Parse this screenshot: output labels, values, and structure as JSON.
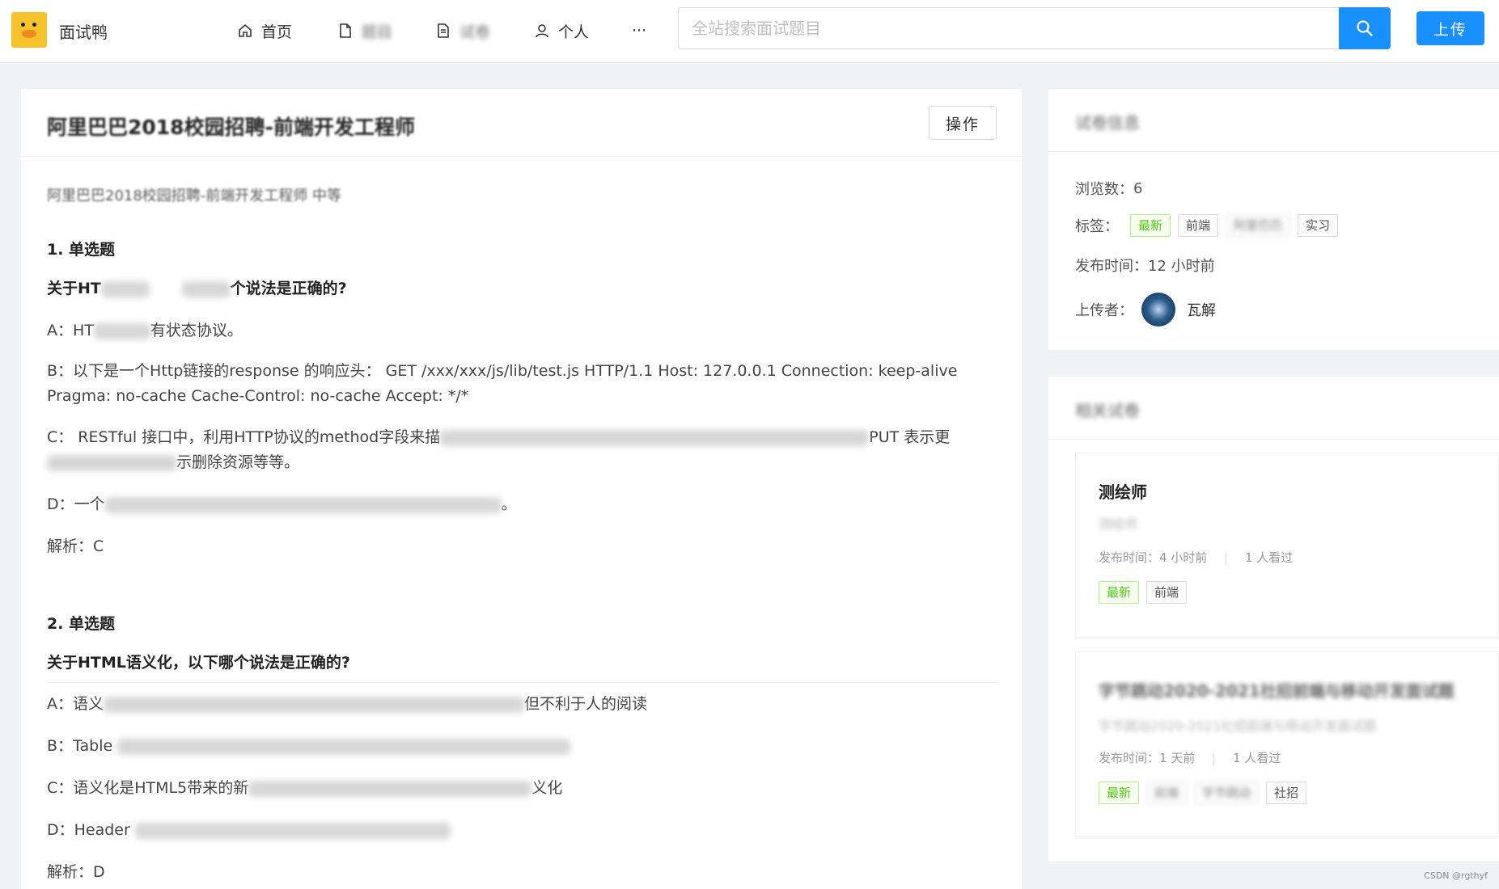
{
  "header": {
    "app_name": "面试鸭",
    "nav": [
      {
        "label": "首页",
        "icon": "home-icon"
      },
      {
        "label": "题目",
        "icon": "file-icon"
      },
      {
        "label": "试卷",
        "icon": "file-text-icon"
      },
      {
        "label": "个人",
        "icon": "user-icon"
      },
      {
        "label": "···",
        "icon": "more-icon"
      }
    ],
    "search_placeholder": "全站搜索面试题目",
    "upload_label": "上传"
  },
  "paper": {
    "title": "阿里巴巴2018校园招聘-前端开发工程师",
    "operate_label": "操作",
    "description": "阿里巴巴2018校园招聘-前端开发工程师 中等",
    "questions": [
      {
        "number": "1. 单选题",
        "text": "关于HTTP协议，以下哪个说法是正确的?",
        "options": [
          "A：HTTP是一种有状态协议。",
          "B：以下是一个Http链接的response 的响应头： GET /xxx/xxx/js/lib/test.js HTTP/1.1 Host: 127.0.0.1 Connection: keep-alive Pragma: no-cache Cache-Control: no-cache Accept: */*",
          "C： RESTful 接口中，利用HTTP协议的method字段来描述要对资源操作的方式，比如GET表示获取资源，POST表示新增一个资源，PUT表示更新资源，DELETE表示删除资源等等。",
          "D：一个HTTP请求返回的HTTP状态码中，304表示临时重定向。"
        ],
        "analysis": "解析：C"
      },
      {
        "number": "2. 单选题",
        "text": "关于HTML语义化，以下哪个说法是正确的?",
        "options": [
          "A：语义化的HTML有利于机器的阅读，如PDA手持设备、搜索引擎爬虫；但不利于人的阅读",
          "B：Table 属于过时的标签，遇到数据列表时，需尽量使用 div 来模拟表格",
          "C：语义化是HTML5带来的新概念，此前版本的HTML无法做到语义化",
          "D：Header、article、address都属于语义化明确的标签"
        ],
        "analysis": "解析：D"
      }
    ]
  },
  "info": {
    "title": "试卷信息",
    "views_label": "浏览数：",
    "views_value": "6",
    "tags_label": "标签：",
    "tags": [
      {
        "label": "最新",
        "green": true
      },
      {
        "label": "前端",
        "green": false
      },
      {
        "label": "阿里巴巴",
        "green": false
      },
      {
        "label": "实习",
        "green": false
      }
    ],
    "time_label": "发布时间：",
    "time_value": "12 小时前",
    "uploader_label": "上传者：",
    "uploader_name": "瓦解"
  },
  "related": {
    "title": "相关试卷",
    "items": [
      {
        "title": "测绘师",
        "sub": "测绘师",
        "meta_time": "发布时间：4 小时前",
        "meta_views": "1 人看过",
        "tags": [
          {
            "label": "最新",
            "green": true
          },
          {
            "label": "前端",
            "green": false
          }
        ]
      },
      {
        "title": "字节跳动2020-2021社招前端与移动开发面试题",
        "sub": "字节跳动2020-2021社招前端与移动开发面试题",
        "meta_time": "发布时间：1 天前",
        "meta_views": "1 人看过",
        "tags": [
          {
            "label": "最新",
            "green": true
          },
          {
            "label": "前端",
            "green": false
          },
          {
            "label": "字节跳动",
            "green": false
          },
          {
            "label": "社招",
            "green": false
          }
        ]
      }
    ]
  },
  "watermark": "CSDN @rgthyf"
}
